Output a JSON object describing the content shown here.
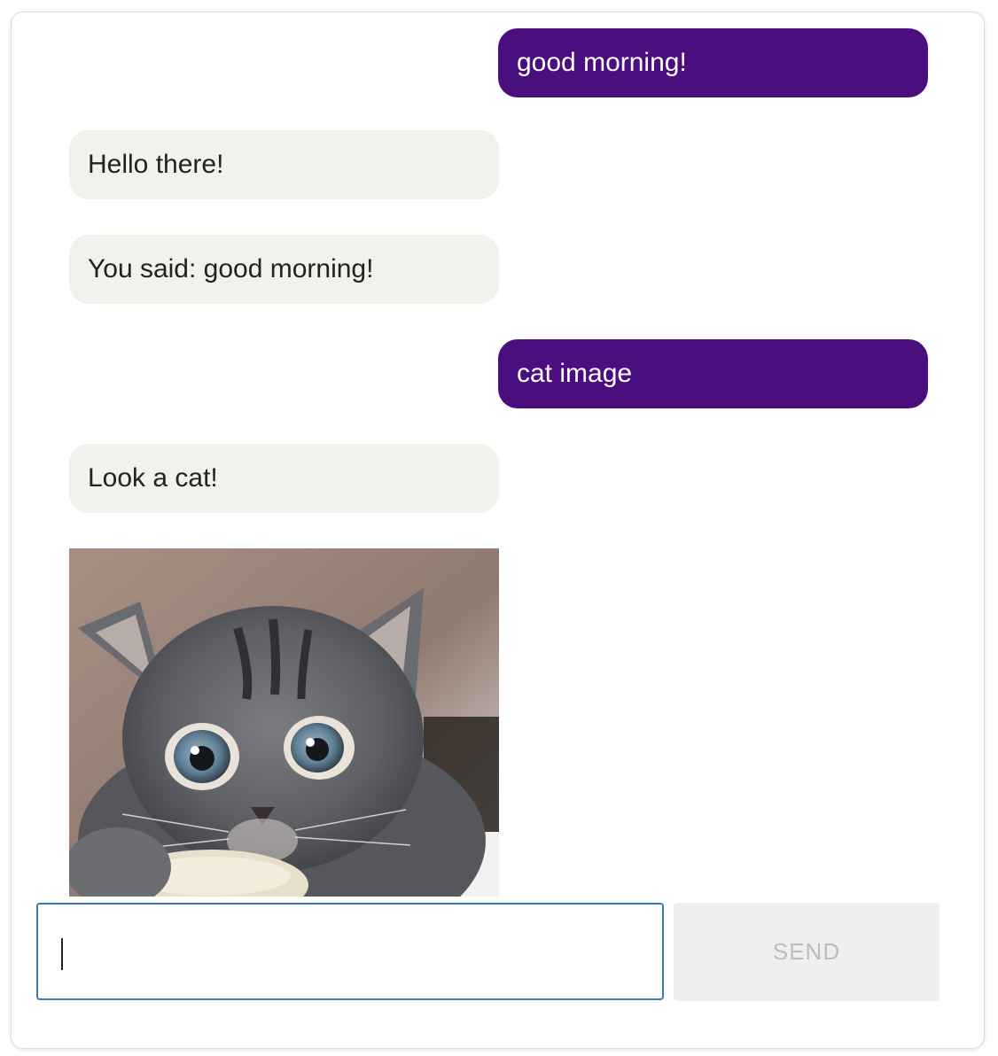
{
  "colors": {
    "user_bubble": "#4a0e7e",
    "bot_bubble": "#f2f1ec",
    "input_focus_border": "#3b78c8",
    "send_bg": "#efefef",
    "send_text": "#bdbdbd"
  },
  "messages": [
    {
      "role": "user",
      "text": "good morning!"
    },
    {
      "role": "bot",
      "text": "Hello there!"
    },
    {
      "role": "bot",
      "text": "You said: good morning!"
    },
    {
      "role": "user",
      "text": "cat image"
    },
    {
      "role": "bot",
      "text": "Look a cat!"
    },
    {
      "role": "bot",
      "type": "image",
      "icon": "kitten-photo"
    }
  ],
  "composer": {
    "value": "",
    "placeholder": "",
    "send_label": "SEND"
  }
}
